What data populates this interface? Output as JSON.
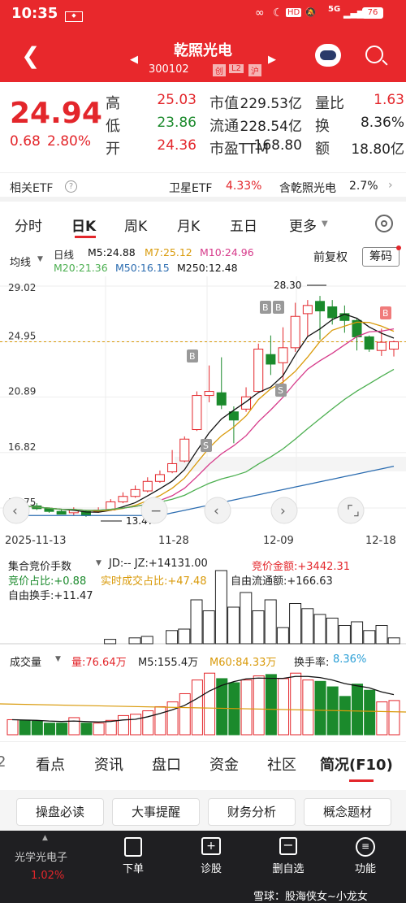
{
  "status": {
    "time": "10:35",
    "battery": "76",
    "net": "5G",
    "hd": "HD"
  },
  "header": {
    "title": "乾照光电",
    "code": "300102",
    "badges": [
      "创",
      "L2",
      "沪"
    ]
  },
  "quote": {
    "price": "24.94",
    "change": "0.68",
    "pct": "2.80%",
    "grid": [
      {
        "label": "高",
        "value": "25.03",
        "color": "red"
      },
      {
        "label": "市值",
        "value": "229.53亿",
        "color": "dark"
      },
      {
        "label": "量比",
        "value": "1.63",
        "color": "red"
      },
      {
        "label": "低",
        "value": "23.86",
        "color": "green"
      },
      {
        "label": "流通",
        "value": "228.54亿",
        "color": "dark"
      },
      {
        "label": "换",
        "value": "8.36%",
        "color": "dark"
      },
      {
        "label": "开",
        "value": "24.36",
        "color": "red"
      },
      {
        "label": "市盈TTM",
        "value": "168.80",
        "color": "dark"
      },
      {
        "label": "额",
        "value": "18.80亿",
        "color": "dark"
      }
    ]
  },
  "etf": {
    "label": "相关ETF",
    "q": "?",
    "item1": "卫星ETF",
    "item1_val": "4.33%",
    "item2": "含乾照光电",
    "item2_val": "2.7%"
  },
  "period_tabs": [
    "分时",
    "日K",
    "周K",
    "月K",
    "五日",
    "更多"
  ],
  "kline": {
    "ma_select": "均线",
    "line_label": "日线",
    "ma": [
      {
        "label": "M5:24.88",
        "color": "#111111"
      },
      {
        "label": "M7:25.12",
        "color": "#d99a0a"
      },
      {
        "label": "M10:24.96",
        "color": "#d63a8a"
      },
      {
        "label": "M20:21.36",
        "color": "#4caf50"
      },
      {
        "label": "M50:16.15",
        "color": "#2b6cb0"
      },
      {
        "label": "M250:12.48",
        "color": "#111111"
      }
    ],
    "fq": "前复权",
    "chip": "筹码",
    "y_ticks": [
      "29.02",
      "24.95",
      "20.89",
      "16.82",
      "12.75"
    ],
    "x_ticks": [
      "2025-11-13",
      "11-28",
      "12-09",
      "12-18"
    ],
    "high_mark": "28.30",
    "low_mark": "13.47",
    "b_label": "B",
    "s_label": "S"
  },
  "auction": {
    "title": "集合竞价手数",
    "jd": "JD:-- JZ:+14131.00",
    "amt": "竞价金额:+3442.31",
    "r1": "竞价占比:+0.88",
    "r2": "实时成交占比:+47.48",
    "r3": "自由流通额:+166.63",
    "r4": "自由换手:+11.47"
  },
  "volume": {
    "title": "成交量",
    "vol": "量:76.64万",
    "m5": "M5:155.4万",
    "m60": "M60:84.33万",
    "turn_label": "换手率:",
    "turn": "8.36%"
  },
  "bottom_tabs": [
    "2",
    "看点",
    "资讯",
    "盘口",
    "资金",
    "社区",
    "简况(F10)"
  ],
  "chips": [
    "操盘必读",
    "大事提醒",
    "财务分析",
    "概念题材"
  ],
  "nav": {
    "sector": "光学光电子",
    "sector_pct": "1.02%",
    "items": [
      "下单",
      "诊股",
      "删自选",
      "功能"
    ],
    "watermark": "雪球：股海侠女~小龙女"
  },
  "colors": {
    "red": "#e3262b",
    "green": "#1b8a2c",
    "header": "#e8282c"
  },
  "chart_data": {
    "type": "candlestick",
    "x_ticks": [
      "2025-11-13",
      "11-28",
      "12-09",
      "12-18"
    ],
    "candles": [
      [
        12.9,
        12.95,
        12.8,
        13.1
      ],
      [
        12.9,
        12.8,
        12.7,
        13.0
      ],
      [
        12.9,
        12.7,
        12.6,
        13.1
      ],
      [
        12.7,
        12.5,
        12.4,
        12.8
      ],
      [
        12.5,
        12.3,
        12.3,
        12.7
      ],
      [
        12.4,
        12.6,
        12.2,
        12.8
      ],
      [
        12.5,
        12.2,
        12.1,
        12.6
      ],
      [
        12.5,
        12.6,
        12.4,
        12.8
      ],
      [
        12.6,
        13.2,
        12.6,
        13.4
      ],
      [
        13.2,
        13.6,
        13.1,
        13.9
      ],
      [
        13.6,
        14.1,
        13.5,
        14.4
      ],
      [
        14.0,
        14.7,
        13.9,
        15.0
      ],
      [
        14.7,
        15.2,
        14.6,
        15.5
      ],
      [
        15.4,
        16.0,
        15.3,
        17.0
      ],
      [
        16.2,
        17.8,
        16.1,
        18.0
      ],
      [
        18.5,
        21.0,
        18.4,
        21.3
      ],
      [
        21.0,
        21.3,
        20.5,
        23.2
      ],
      [
        21.2,
        20.3,
        20.0,
        23.8
      ],
      [
        19.8,
        19.2,
        17.5,
        20.2
      ],
      [
        20.0,
        20.9,
        19.8,
        21.6
      ],
      [
        21.3,
        24.4,
        21.2,
        24.8
      ],
      [
        24.0,
        23.3,
        22.5,
        25.4
      ],
      [
        23.4,
        24.5,
        21.5,
        26.0
      ],
      [
        24.5,
        26.8,
        24.2,
        27.8
      ],
      [
        27.0,
        27.6,
        25.3,
        28.0
      ],
      [
        27.9,
        27.2,
        25.1,
        28.3
      ],
      [
        27.5,
        26.7,
        26.2,
        28.0
      ],
      [
        27.0,
        26.5,
        25.6,
        27.6
      ],
      [
        26.5,
        25.3,
        24.3,
        26.7
      ],
      [
        25.3,
        24.4,
        24.2,
        25.4
      ],
      [
        24.3,
        24.9,
        23.9,
        25.9
      ],
      [
        24.4,
        24.94,
        23.86,
        25.03
      ]
    ],
    "y_range": [
      12.75,
      29.02
    ],
    "volume": [
      220,
      210,
      200,
      170,
      170,
      250,
      170,
      170,
      210,
      280,
      300,
      350,
      410,
      480,
      600,
      800,
      900,
      820,
      760,
      800,
      860,
      880,
      820,
      900,
      800,
      780,
      700,
      560,
      740,
      650,
      480,
      500
    ]
  }
}
